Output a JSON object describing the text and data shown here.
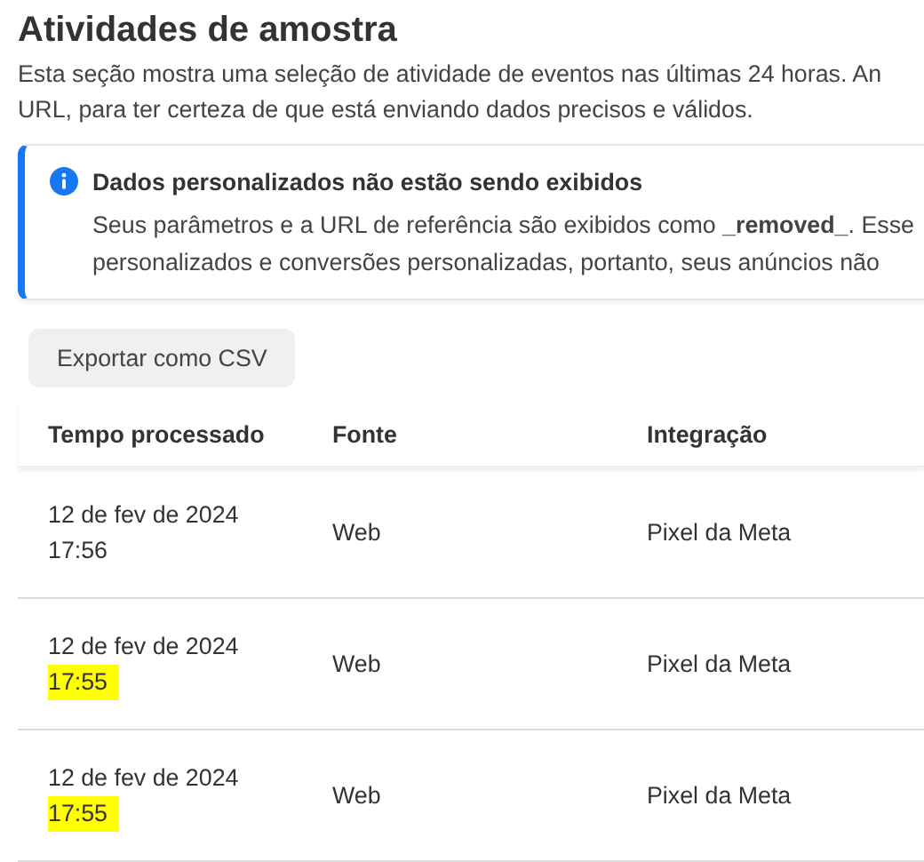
{
  "title": "Atividades de amostra",
  "description": "Esta seção mostra uma seleção de atividade de eventos nas últimas 24 horas. An\nURL, para ter certeza de que está enviando dados precisos e válidos.",
  "notice": {
    "kind": "info",
    "title": "Dados personalizados não estão sendo exibidos",
    "body": "Seus parâmetros e a URL de referência são exibidos como **_removed_**. Esse\npersonalizados e conversões personalizadas, portanto, seus anúncios não"
  },
  "export_button": "Exportar como CSV",
  "table": {
    "columns": [
      "Tempo processado",
      "Fonte",
      "Integração"
    ],
    "rows": [
      {
        "date": "12 de fev de 2024",
        "time": "17:56",
        "time_highlighted": false,
        "source": "Web",
        "integration": "Pixel da Meta"
      },
      {
        "date": "12 de fev de 2024",
        "time": "17:55",
        "time_highlighted": true,
        "source": "Web",
        "integration": "Pixel da Meta"
      },
      {
        "date": "12 de fev de 2024",
        "time": "17:55",
        "time_highlighted": true,
        "source": "Web",
        "integration": "Pixel da Meta"
      }
    ]
  }
}
